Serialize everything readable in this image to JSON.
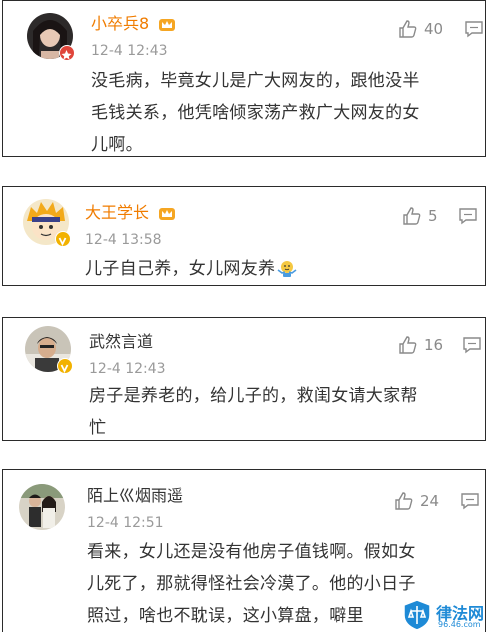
{
  "comments": [
    {
      "username": "小卒兵8",
      "timestamp": "12-4 12:43",
      "likes": "40",
      "content_lines": [
        "没毛病，毕竟女儿是广大网友的，跟他没半",
        "毛钱关系，他凭啥倾家荡产救广大网友的女",
        "儿啊。"
      ],
      "name_color": "#f07c00",
      "avatar": "woman-photo",
      "badge_color": "#e0453a"
    },
    {
      "username": "大王学长",
      "timestamp": "12-4 13:58",
      "likes": "5",
      "content_lines": [
        "儿子自己养，女儿网友养"
      ],
      "name_color": "#f07c00",
      "avatar": "anime-character",
      "badge_color": "#f2b200",
      "emoji": "shrug-emoji"
    },
    {
      "username": "武然言道",
      "timestamp": "12-4 12:43",
      "likes": "16",
      "content_lines": [
        "房子是养老的，给儿子的，救闺女请大家帮",
        "忙"
      ],
      "name_color": "#333333",
      "avatar": "man-photo",
      "badge_color": "#f2b200"
    },
    {
      "username": "陌上巛烟雨遥",
      "timestamp": "12-4 12:51",
      "likes": "24",
      "content_lines": [
        "看来，女儿还是没有他房子值钱啊。假如女",
        "儿死了，那就得怪社会冷漠了。他的小日子",
        "照过，啥也不耽误，这小算盘，噼里"
      ],
      "name_color": "#333333",
      "avatar": "couple-photo"
    }
  ],
  "watermark": {
    "text": "律法网",
    "subtext": "96.46.com"
  }
}
